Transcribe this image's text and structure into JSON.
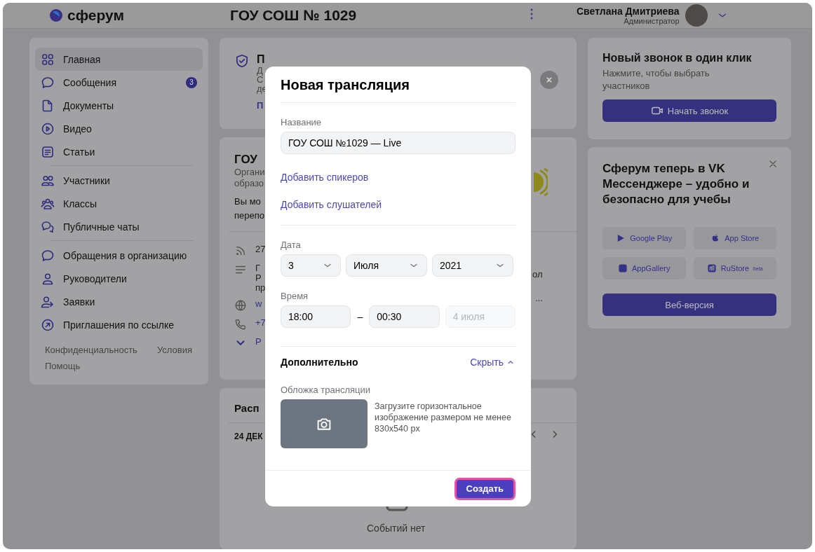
{
  "header": {
    "logo": "сферум",
    "org": "ГОУ СОШ № 1029",
    "user_name": "Светлана Дмитриева",
    "user_role": "Администратор"
  },
  "sidebar": {
    "groups": [
      [
        {
          "label": "Главная",
          "selected": true
        },
        {
          "label": "Сообщения",
          "selected": false,
          "badge": "3"
        },
        {
          "label": "Документы",
          "selected": false
        },
        {
          "label": "Видео",
          "selected": false
        },
        {
          "label": "Статьи",
          "selected": false
        }
      ],
      [
        {
          "label": "Участники",
          "selected": false
        },
        {
          "label": "Классы",
          "selected": false
        },
        {
          "label": "Публичные чаты",
          "selected": false
        }
      ],
      [
        {
          "label": "Обращения в организацию",
          "selected": false
        },
        {
          "label": "Руководители",
          "selected": false
        },
        {
          "label": "Заявки",
          "selected": false
        },
        {
          "label": "Приглашения по ссылке",
          "selected": false
        }
      ]
    ],
    "footer_links": [
      "Конфиденциальность",
      "Условия",
      "Помощь"
    ]
  },
  "middle": {
    "notice": {
      "title": "П",
      "lines": [
        "Д",
        "С",
        "де"
      ],
      "link": "П"
    },
    "org_card": {
      "title": "ГОУ",
      "subtitle": [
        "Органи",
        "образо"
      ],
      "body": [
        "Вы мо",
        "перепо"
      ],
      "info": [
        {
          "kind": "feed",
          "text": [
            "27"
          ]
        },
        {
          "kind": "about",
          "text": [
            "Г",
            "Р",
            "пр"
          ]
        },
        {
          "kind": "site",
          "text": [
            "w"
          ]
        },
        {
          "kind": "phone",
          "text": [
            "+7"
          ]
        },
        {
          "kind": "more",
          "text": [
            "Р"
          ]
        }
      ],
      "right_texts": [
        "ол",
        "..."
      ]
    },
    "schedule": {
      "title": "Расп",
      "date": "24 ДЕК",
      "empty": "Событий нет"
    }
  },
  "right": {
    "call": {
      "title": "Новый звонок в один клик",
      "subtitle": "Нажмите, чтобы выбрать участников",
      "button": "Начать звонок"
    },
    "promo": {
      "title": "Сферум теперь в VK Мессенджере – удобно и безопасно для учебы",
      "stores": [
        {
          "label": "Google Play"
        },
        {
          "label": "App Store"
        },
        {
          "label": "AppGallery"
        },
        {
          "label": "RuStore",
          "sup": "beta"
        }
      ],
      "button": "Веб-версия"
    }
  },
  "modal": {
    "title": "Новая трансляция",
    "name_label": "Название",
    "name_value": "ГОУ СОШ №1029 — Live",
    "links": [
      "Добавить спикеров",
      "Добавить слушателей"
    ],
    "date_label": "Дата",
    "date": [
      "3",
      "Июля",
      "2021"
    ],
    "time_label": "Время",
    "time_start": "18:00",
    "time_sep": "–",
    "time_end": "00:30",
    "end_date": {
      "text": "4 июля",
      "disabled": true
    },
    "extra": {
      "title": "Дополнительно",
      "toggle": "Скрыть",
      "expanded": true
    },
    "cover_label": "Обложка трансляции",
    "cover_hint": "Загрузите горизонтальное изображение размером не менее 830x540 px",
    "create": {
      "label": "Создать",
      "highlighted": true
    }
  }
}
